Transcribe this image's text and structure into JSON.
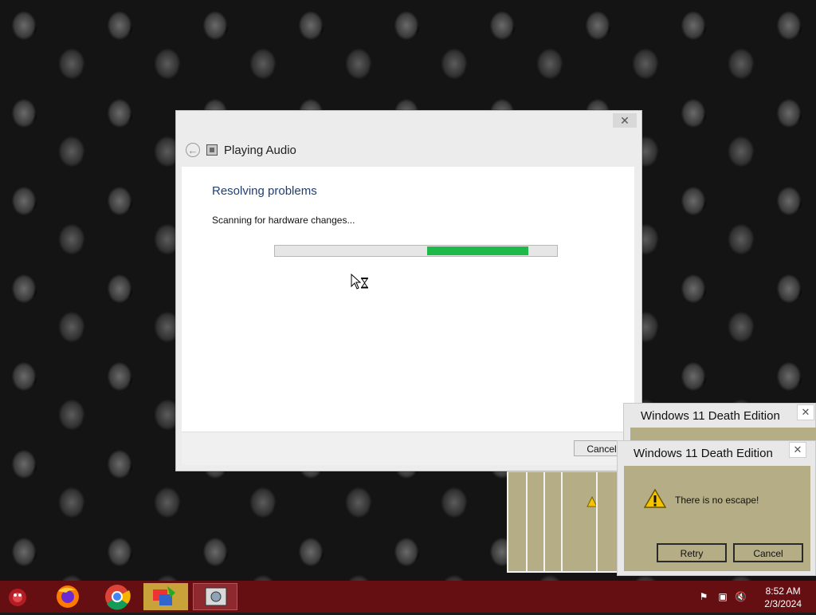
{
  "troubleshooter": {
    "title": "Playing Audio",
    "heading": "Resolving problems",
    "status": "Scanning for hardware changes...",
    "progress_percent": 36,
    "cancel_label": "Cancel",
    "close_glyph": "✕",
    "back_glyph": "←"
  },
  "dialog_back": {
    "title": "Windows 11 Death Edition",
    "close_glyph": "✕"
  },
  "dialog_front": {
    "title": "Windows 11 Death Edition",
    "close_glyph": "✕",
    "message": "There is no escape!",
    "retry_label": "Retry",
    "cancel_label": "Cancel",
    "icon": "warning-icon"
  },
  "taskbar": {
    "apps": [
      "start-orb-icon",
      "firefox-icon",
      "chrome-icon",
      "paint-icon",
      "troubleshooter-icon"
    ],
    "tray": [
      "flag-icon",
      "network-icon",
      "volume-muted-icon"
    ],
    "time": "8:52 AM",
    "date": "2/3/2024"
  },
  "colors": {
    "taskbar": "#650f13",
    "progress": "#1fb94a",
    "dialog_body": "#b5ad85",
    "heading": "#1f3f73"
  }
}
